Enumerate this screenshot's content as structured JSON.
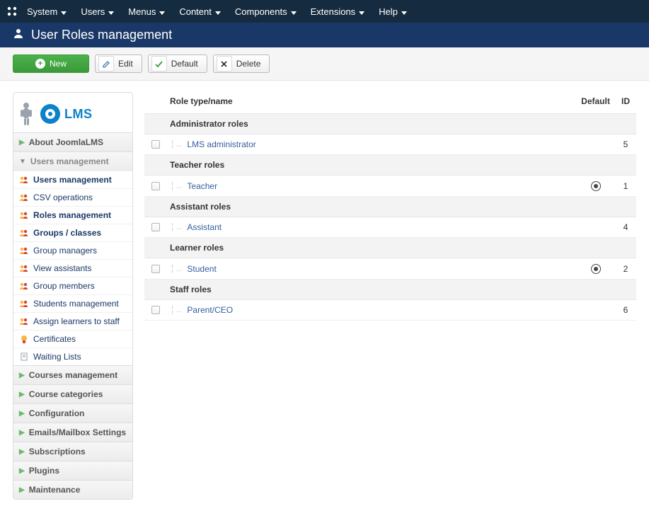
{
  "topnav": {
    "items": [
      "System",
      "Users",
      "Menus",
      "Content",
      "Components",
      "Extensions",
      "Help"
    ]
  },
  "header": {
    "title": "User Roles management"
  },
  "toolbar": {
    "new_label": "New",
    "edit_label": "Edit",
    "default_label": "Default",
    "delete_label": "Delete"
  },
  "sidebar": {
    "logo_text": "LMS",
    "sections_top": [
      {
        "label": "About JoomlaLMS",
        "expanded": false
      }
    ],
    "users_section": {
      "label": "Users management",
      "expanded": true
    },
    "users_items": [
      {
        "label": "Users management",
        "bold": true,
        "icon": "users"
      },
      {
        "label": "CSV operations",
        "bold": false,
        "icon": "users"
      },
      {
        "label": "Roles management",
        "bold": true,
        "icon": "users"
      },
      {
        "label": "Groups / classes",
        "bold": true,
        "icon": "users"
      },
      {
        "label": "Group managers",
        "bold": false,
        "icon": "users"
      },
      {
        "label": "View assistants",
        "bold": false,
        "icon": "users"
      },
      {
        "label": "Group members",
        "bold": false,
        "icon": "users"
      },
      {
        "label": "Students management",
        "bold": false,
        "icon": "users"
      },
      {
        "label": "Assign learners to staff",
        "bold": false,
        "icon": "users"
      },
      {
        "label": "Certificates",
        "bold": false,
        "icon": "cert"
      },
      {
        "label": "Waiting Lists",
        "bold": false,
        "icon": "doc"
      }
    ],
    "sections_bottom": [
      {
        "label": "Courses management"
      },
      {
        "label": "Course categories"
      },
      {
        "label": "Configuration"
      },
      {
        "label": "Emails/Mailbox Settings"
      },
      {
        "label": "Subscriptions"
      },
      {
        "label": "Plugins"
      },
      {
        "label": "Maintenance"
      }
    ]
  },
  "table": {
    "headers": {
      "name": "Role type/name",
      "default": "Default",
      "id": "ID"
    },
    "rows": [
      {
        "type": "group",
        "label": "Administrator roles"
      },
      {
        "type": "role",
        "name": "LMS administrator",
        "default": false,
        "id": "5"
      },
      {
        "type": "group",
        "label": "Teacher roles"
      },
      {
        "type": "role",
        "name": "Teacher",
        "default": true,
        "id": "1"
      },
      {
        "type": "group",
        "label": "Assistant roles"
      },
      {
        "type": "role",
        "name": "Assistant",
        "default": false,
        "id": "4"
      },
      {
        "type": "group",
        "label": "Learner roles"
      },
      {
        "type": "role",
        "name": "Student",
        "default": true,
        "id": "2"
      },
      {
        "type": "group",
        "label": "Staff roles"
      },
      {
        "type": "role",
        "name": "Parent/CEO",
        "default": false,
        "id": "6"
      }
    ]
  }
}
